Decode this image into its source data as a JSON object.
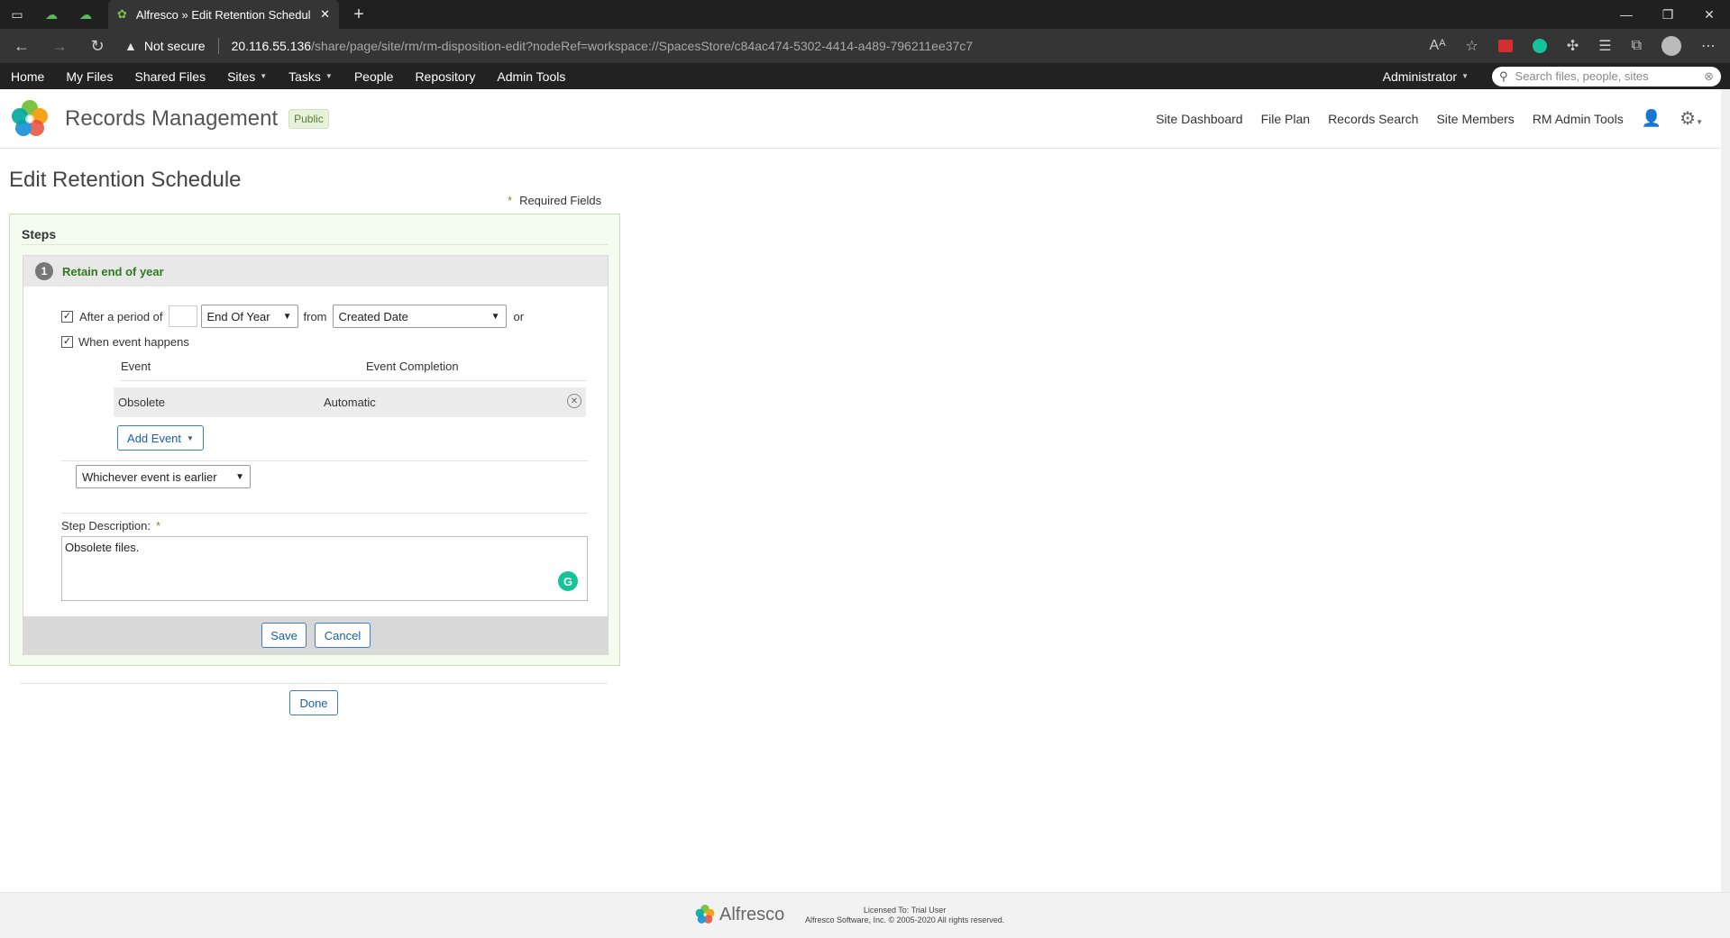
{
  "browser": {
    "tab_title": "Alfresco » Edit Retention Schedule",
    "not_secure": "Not secure",
    "url_host": "20.116.55.136",
    "url_path": "/share/page/site/rm/rm-disposition-edit?nodeRef=workspace://SpacesStore/c84ac474-5302-4414-a489-796211ee37c7"
  },
  "appnav": {
    "items": [
      "Home",
      "My Files",
      "Shared Files",
      "Sites",
      "Tasks",
      "People",
      "Repository",
      "Admin Tools"
    ],
    "user": "Administrator",
    "search_placeholder": "Search files, people, sites"
  },
  "site": {
    "title": "Records Management",
    "badge": "Public",
    "nav": [
      "Site Dashboard",
      "File Plan",
      "Records Search",
      "Site Members",
      "RM Admin Tools"
    ]
  },
  "page": {
    "title": "Edit Retention Schedule",
    "required_star": "*",
    "required_label": "Required Fields",
    "steps_label": "Steps",
    "step": {
      "number": "1",
      "title": "Retain end of year",
      "after_period_label": "After a period of",
      "period_value": "",
      "period_unit": "End Of Year",
      "from_label": "from",
      "from_value": "Created Date",
      "or_label": "or",
      "when_event_label": "When event happens",
      "event_header": "Event",
      "completion_header": "Event Completion",
      "events": [
        {
          "event": "Obsolete",
          "completion": "Automatic"
        }
      ],
      "add_event_label": "Add Event",
      "whichever_value": "Whichever event is earlier",
      "desc_label": "Step Description:",
      "desc_value": "Obsolete files.",
      "save_label": "Save",
      "cancel_label": "Cancel"
    },
    "done_label": "Done"
  },
  "footer": {
    "brand": "Alfresco",
    "license_line1": "Licensed To: Trial User",
    "license_line2": "Alfresco Software, Inc. © 2005-2020 All rights reserved."
  },
  "colors": {
    "accent_green": "#2f7a1f",
    "button_blue": "#1b5fa8",
    "nav_dark": "#222222"
  }
}
